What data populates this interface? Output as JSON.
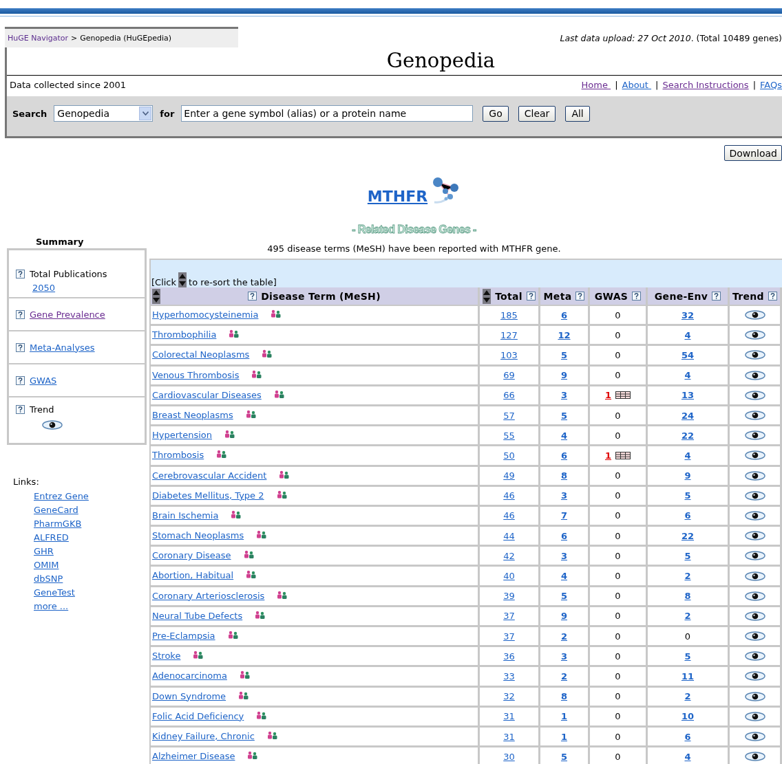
{
  "breadcrumb": {
    "items": [
      {
        "label": "HuGE Navigator",
        "visited": true
      },
      {
        "label": "Genopedia (HuGEpedia)",
        "visited": false
      }
    ],
    "separator": ">"
  },
  "upload_note": "*Last data upload: 27 Oct 2010*. (Total 10489 genes)",
  "title": "Genopedia",
  "since": "Data collected since 2001",
  "nav": {
    "separator": "|",
    "links": [
      {
        "label": "Home ",
        "visited": true
      },
      {
        "label": "About ",
        "visited": false
      },
      {
        "label": "Search Instructions",
        "visited": true
      },
      {
        "label": "FAQs",
        "visited": false
      }
    ]
  },
  "search": {
    "label": "Search",
    "database": "Genopedia",
    "for": "for",
    "query": "Enter a gene symbol (alias) or a protein name",
    "buttons": [
      "Go",
      "Clear",
      "All"
    ]
  },
  "download": "Download",
  "gene": "MTHFR",
  "banner": "- Related Disease Genes -",
  "summary": {
    "title": "Summary",
    "items": [
      {
        "kind": "count",
        "label": "Total Publications",
        "value": "2050"
      },
      {
        "kind": "link",
        "label": "Gene Prevalence",
        "visited": true
      },
      {
        "kind": "link",
        "label": "Meta-Analyses",
        "visited": false
      },
      {
        "kind": "link",
        "label": "GWAS",
        "visited": false
      },
      {
        "kind": "trend",
        "label": "Trend"
      }
    ]
  },
  "links": {
    "title": "Links:",
    "items": [
      "Entrez Gene",
      "GeneCard",
      "PharmGKB",
      "ALFRED",
      "GHR",
      "OMIM",
      "dbSNP",
      "GeneTest",
      "more ..."
    ]
  },
  "table": {
    "note": "495 disease terms (MeSH) have been reported with MTHFR gene.",
    "hint_before": "[Click",
    "hint_after": "to re-sort the table]",
    "columns": [
      {
        "label": "Disease Term (MeSH)",
        "sortable": true
      },
      {
        "label": "Total",
        "sortable": true
      },
      {
        "label": "Meta",
        "sortable": false
      },
      {
        "label": "GWAS",
        "sortable": false
      },
      {
        "label": "Gene-Env",
        "sortable": false
      },
      {
        "label": "Trend",
        "sortable": false
      }
    ],
    "rows": [
      {
        "term": "Hyperhomocysteinemia",
        "total": "185",
        "meta": "6",
        "gwas": {
          "value": "0",
          "linked": false
        },
        "gene_env": {
          "value": "32",
          "linked": true
        }
      },
      {
        "term": "Thrombophilia",
        "total": "127",
        "meta": "12",
        "gwas": {
          "value": "0",
          "linked": false
        },
        "gene_env": {
          "value": "4",
          "linked": true
        }
      },
      {
        "term": "Colorectal Neoplasms",
        "total": "103",
        "meta": "5",
        "gwas": {
          "value": "0",
          "linked": false
        },
        "gene_env": {
          "value": "54",
          "linked": true
        }
      },
      {
        "term": "Venous Thrombosis",
        "total": "69",
        "meta": "9",
        "gwas": {
          "value": "0",
          "linked": false
        },
        "gene_env": {
          "value": "4",
          "linked": true
        }
      },
      {
        "term": "Cardiovascular Diseases",
        "total": "66",
        "meta": "3",
        "gwas": {
          "value": "1",
          "linked": true
        },
        "gene_env": {
          "value": "13",
          "linked": true
        }
      },
      {
        "term": "Breast Neoplasms",
        "total": "57",
        "meta": "5",
        "gwas": {
          "value": "0",
          "linked": false
        },
        "gene_env": {
          "value": "24",
          "linked": true
        }
      },
      {
        "term": "Hypertension",
        "total": "55",
        "meta": "4",
        "gwas": {
          "value": "0",
          "linked": false
        },
        "gene_env": {
          "value": "22",
          "linked": true
        }
      },
      {
        "term": "Thrombosis",
        "total": "50",
        "meta": "6",
        "gwas": {
          "value": "1",
          "linked": true
        },
        "gene_env": {
          "value": "4",
          "linked": true
        }
      },
      {
        "term": "Cerebrovascular Accident",
        "total": "49",
        "meta": "8",
        "gwas": {
          "value": "0",
          "linked": false
        },
        "gene_env": {
          "value": "9",
          "linked": true
        }
      },
      {
        "term": "Diabetes Mellitus, Type 2",
        "total": "46",
        "meta": "3",
        "gwas": {
          "value": "0",
          "linked": false
        },
        "gene_env": {
          "value": "5",
          "linked": true
        }
      },
      {
        "term": "Brain Ischemia",
        "total": "46",
        "meta": "7",
        "gwas": {
          "value": "0",
          "linked": false
        },
        "gene_env": {
          "value": "6",
          "linked": true
        }
      },
      {
        "term": "Stomach Neoplasms",
        "total": "44",
        "meta": "6",
        "gwas": {
          "value": "0",
          "linked": false
        },
        "gene_env": {
          "value": "22",
          "linked": true
        }
      },
      {
        "term": "Coronary Disease",
        "total": "42",
        "meta": "3",
        "gwas": {
          "value": "0",
          "linked": false
        },
        "gene_env": {
          "value": "5",
          "linked": true
        }
      },
      {
        "term": "Abortion, Habitual",
        "total": "40",
        "meta": "4",
        "gwas": {
          "value": "0",
          "linked": false
        },
        "gene_env": {
          "value": "2",
          "linked": true
        }
      },
      {
        "term": "Coronary Arteriosclerosis",
        "total": "39",
        "meta": "5",
        "gwas": {
          "value": "0",
          "linked": false
        },
        "gene_env": {
          "value": "8",
          "linked": true
        }
      },
      {
        "term": "Neural Tube Defects",
        "total": "37",
        "meta": "9",
        "gwas": {
          "value": "0",
          "linked": false
        },
        "gene_env": {
          "value": "2",
          "linked": true
        }
      },
      {
        "term": "Pre-Eclampsia",
        "total": "37",
        "meta": "2",
        "gwas": {
          "value": "0",
          "linked": false
        },
        "gene_env": {
          "value": "0",
          "linked": false
        }
      },
      {
        "term": "Stroke",
        "total": "36",
        "meta": "3",
        "gwas": {
          "value": "0",
          "linked": false
        },
        "gene_env": {
          "value": "5",
          "linked": true
        }
      },
      {
        "term": "Adenocarcinoma",
        "total": "33",
        "meta": "2",
        "gwas": {
          "value": "0",
          "linked": false
        },
        "gene_env": {
          "value": "11",
          "linked": true
        }
      },
      {
        "term": "Down Syndrome",
        "total": "32",
        "meta": "8",
        "gwas": {
          "value": "0",
          "linked": false
        },
        "gene_env": {
          "value": "2",
          "linked": true
        }
      },
      {
        "term": "Folic Acid Deficiency",
        "total": "31",
        "meta": "1",
        "gwas": {
          "value": "0",
          "linked": false
        },
        "gene_env": {
          "value": "10",
          "linked": true
        }
      },
      {
        "term": "Kidney Failure, Chronic",
        "total": "31",
        "meta": "1",
        "gwas": {
          "value": "0",
          "linked": false
        },
        "gene_env": {
          "value": "6",
          "linked": true
        }
      },
      {
        "term": "Alzheimer Disease",
        "total": "30",
        "meta": "5",
        "gwas": {
          "value": "0",
          "linked": false
        },
        "gene_env": {
          "value": "4",
          "linked": true
        }
      }
    ]
  }
}
